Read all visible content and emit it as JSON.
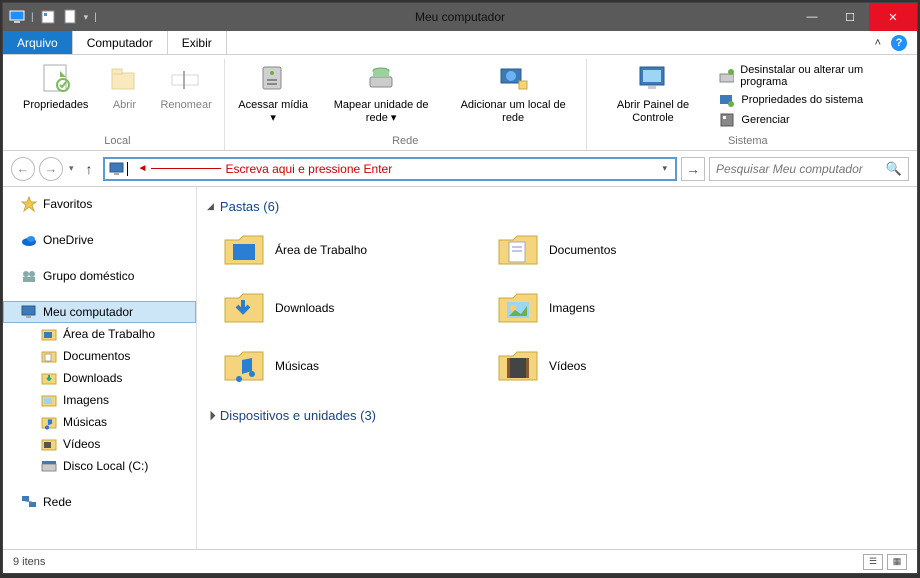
{
  "window": {
    "title": "Meu computador"
  },
  "tabs": {
    "file": "Arquivo",
    "computer": "Computador",
    "view": "Exibir"
  },
  "ribbon": {
    "local": {
      "properties": "Propriedades",
      "open": "Abrir",
      "rename": "Renomear",
      "group": "Local"
    },
    "network": {
      "access_media": "Acessar mídia ▾",
      "map_drive": "Mapear unidade de rede ▾",
      "add_location": "Adicionar um local de rede",
      "group": "Rede"
    },
    "system": {
      "control_panel": "Abrir Painel de Controle",
      "uninstall": "Desinstalar ou alterar um programa",
      "sys_props": "Propriedades do sistema",
      "manage": "Gerenciar",
      "group": "Sistema"
    }
  },
  "navbar": {
    "hint": "Escreva aqui e pressione Enter",
    "search_placeholder": "Pesquisar Meu computador"
  },
  "sidebar": {
    "favorites": "Favoritos",
    "onedrive": "OneDrive",
    "homegroup": "Grupo doméstico",
    "this_pc": "Meu computador",
    "children": {
      "desktop": "Área de Trabalho",
      "documents": "Documentos",
      "downloads": "Downloads",
      "pictures": "Imagens",
      "music": "Músicas",
      "videos": "Vídeos",
      "local_disk": "Disco Local (C:)"
    },
    "network": "Rede"
  },
  "content": {
    "folders_header": "Pastas (6)",
    "devices_header": "Dispositivos e unidades (3)",
    "folders": {
      "desktop": "Área de Trabalho",
      "documents": "Documentos",
      "downloads": "Downloads",
      "pictures": "Imagens",
      "music": "Músicas",
      "videos": "Vídeos"
    }
  },
  "statusbar": {
    "item_count": "9 itens"
  }
}
